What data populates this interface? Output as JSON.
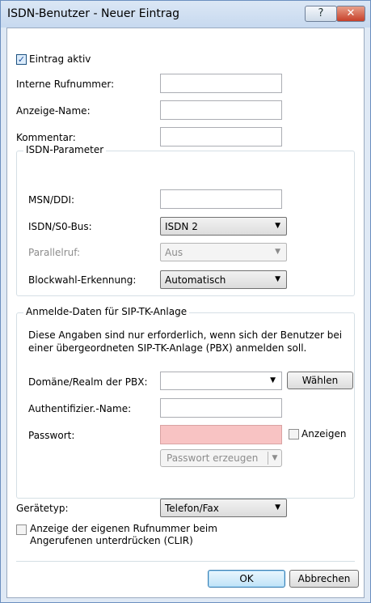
{
  "window": {
    "title": "ISDN-Benutzer - Neuer Eintrag",
    "help_glyph": "?",
    "close_glyph": "✕"
  },
  "main": {
    "entry_active_label": "Eintrag aktiv",
    "entry_active_checked": true,
    "internal_number_label": "Interne Rufnummer:",
    "internal_number_value": "",
    "display_name_label": "Anzeige-Name:",
    "display_name_value": "",
    "comment_label": "Kommentar:",
    "comment_value": ""
  },
  "isdn": {
    "legend": "ISDN-Parameter",
    "msn_label": "MSN/DDI:",
    "msn_value": "",
    "bus_label": "ISDN/S0-Bus:",
    "bus_value": "ISDN 2",
    "parallel_label": "Parallelruf:",
    "parallel_value": "Aus",
    "block_label": "Blockwahl-Erkennung:",
    "block_value": "Automatisch"
  },
  "sip": {
    "legend": "Anmelde-Daten für SIP-TK-Anlage",
    "info_line1": "Diese Angaben sind nur erforderlich, wenn sich der Benutzer bei",
    "info_line2": "einer übergeordneten SIP-TK-Anlage (PBX) anmelden soll.",
    "domain_label": "Domäne/Realm der PBX:",
    "domain_value": "",
    "choose_label": "Wählen",
    "auth_label": "Authentifizier.-Name:",
    "auth_value": "",
    "password_label": "Passwort:",
    "password_value": "",
    "show_label": "Anzeigen",
    "show_checked": false,
    "generate_label": "Passwort erzeugen"
  },
  "device": {
    "type_label": "Gerätetyp:",
    "type_value": "Telefon/Fax",
    "clir_line1": "Anzeige der eigenen Rufnummer beim",
    "clir_line2": "Angerufenen unterdrücken (CLIR)",
    "clir_checked": false
  },
  "footer": {
    "ok_label": "OK",
    "cancel_label": "Abbrechen"
  },
  "icons": {
    "dropdown_arrow": "▼",
    "check_mark": "✓"
  }
}
